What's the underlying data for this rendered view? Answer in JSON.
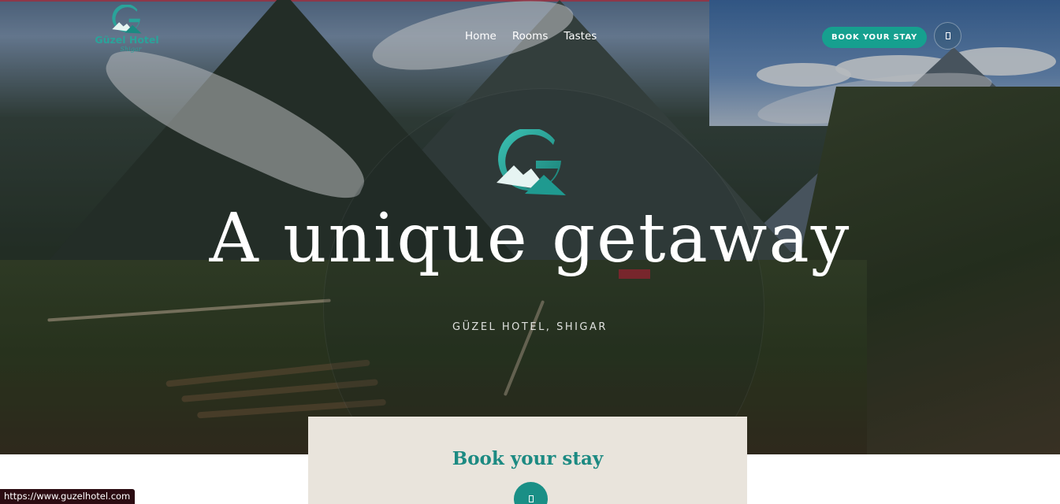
{
  "brand": {
    "name": "Güzel Hotel",
    "location_tag": "Shigar",
    "logo_icon": "g-mountain-logo-icon",
    "accent_color": "#16a08f"
  },
  "nav": {
    "items": [
      {
        "label": "Home"
      },
      {
        "label": "Rooms"
      },
      {
        "label": "Tastes"
      }
    ]
  },
  "header": {
    "book_label": "BOOK YOUR STAY",
    "menu_icon": "menu-icon"
  },
  "hero": {
    "headline": "A unique getaway",
    "subline": "GÜZEL HOTEL, SHIGAR"
  },
  "booking_panel": {
    "title": "Book your stay",
    "button_icon": "calendar-icon"
  },
  "status_bar": {
    "url": "https://www.guzelhotel.com"
  }
}
